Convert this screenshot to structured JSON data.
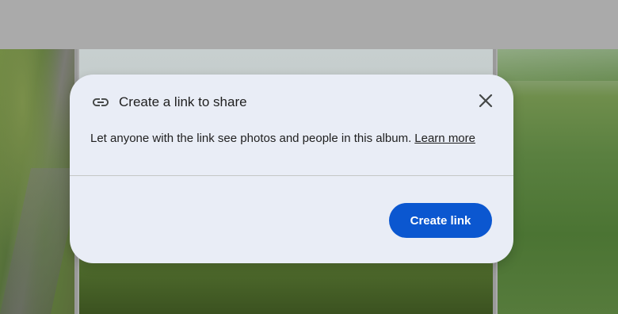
{
  "dialog": {
    "title": "Create a link to share",
    "description": "Let anyone with the link see photos and people in this album.",
    "learn_more_label": "Learn more",
    "primary_action_label": "Create link",
    "icons": {
      "title_icon": "link-icon",
      "close_icon": "close-icon"
    }
  },
  "colors": {
    "dialog_background": "#e9edf6",
    "primary_button": "#0b57d0",
    "scrim": "#aaaaaa"
  }
}
